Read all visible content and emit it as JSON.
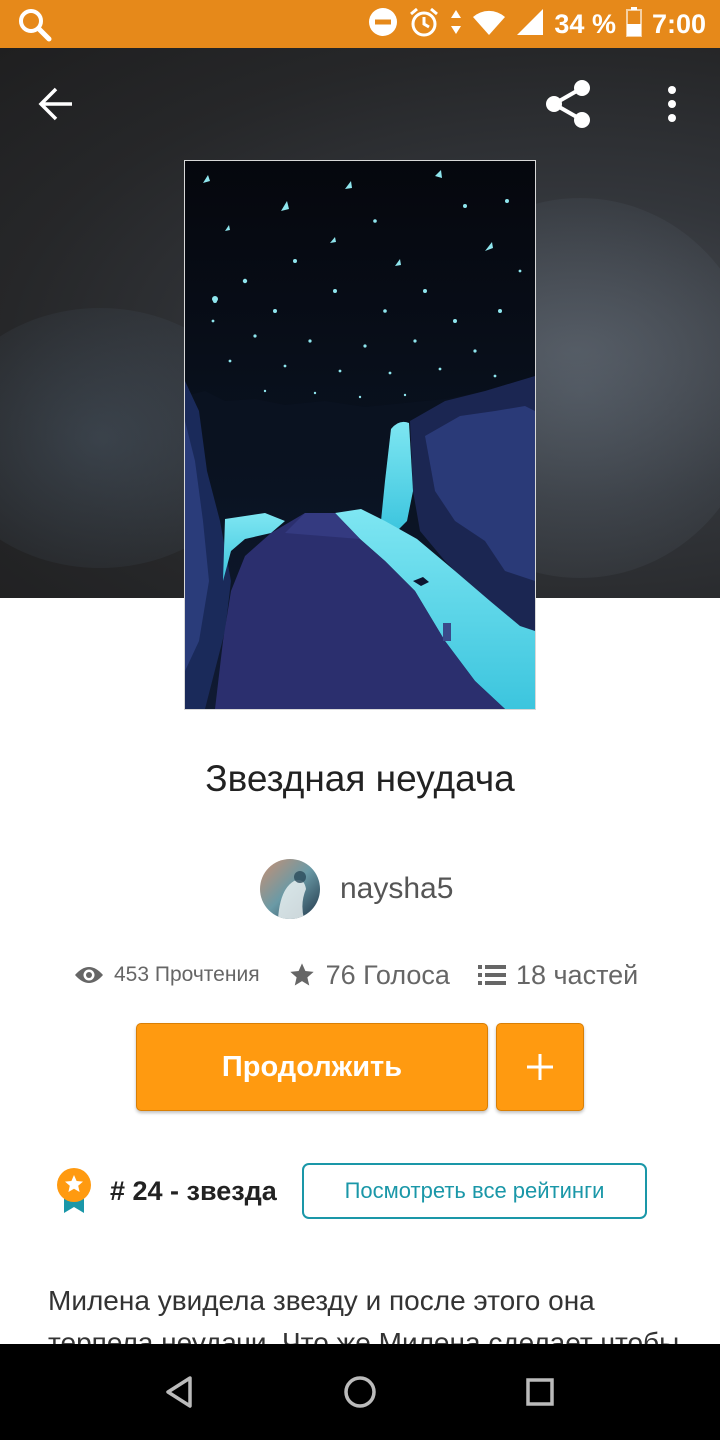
{
  "status_bar": {
    "battery": "34 %",
    "time": "7:00",
    "icons": [
      "search-icon",
      "do-not-disturb-icon",
      "alarm-icon",
      "data-arrows-icon",
      "wifi-icon",
      "signal-icon",
      "battery-icon"
    ]
  },
  "toolbar": {
    "icons": [
      "back-arrow-icon",
      "share-icon",
      "more-vert-icon"
    ]
  },
  "story": {
    "title": "Звездная неудача",
    "author": "naysha5",
    "stats": {
      "reads": "453 Прочтения",
      "votes": "76 Голоса",
      "parts": "18 частей"
    },
    "continue_label": "Продолжить",
    "rank_text": "# 24 - звезда",
    "ratings_button": "Посмотреть все рейтинги",
    "description": "Милена увидела звезду и после этого она терпела неудачи. Что же Милена сделает чтобы"
  },
  "colors": {
    "accent": "#ff9a10",
    "status_bar": "#e6891a",
    "teal": "#1a97a8"
  },
  "nav_bar": {
    "icons": [
      "back-triangle-icon",
      "home-circle-icon",
      "recents-square-icon"
    ]
  }
}
